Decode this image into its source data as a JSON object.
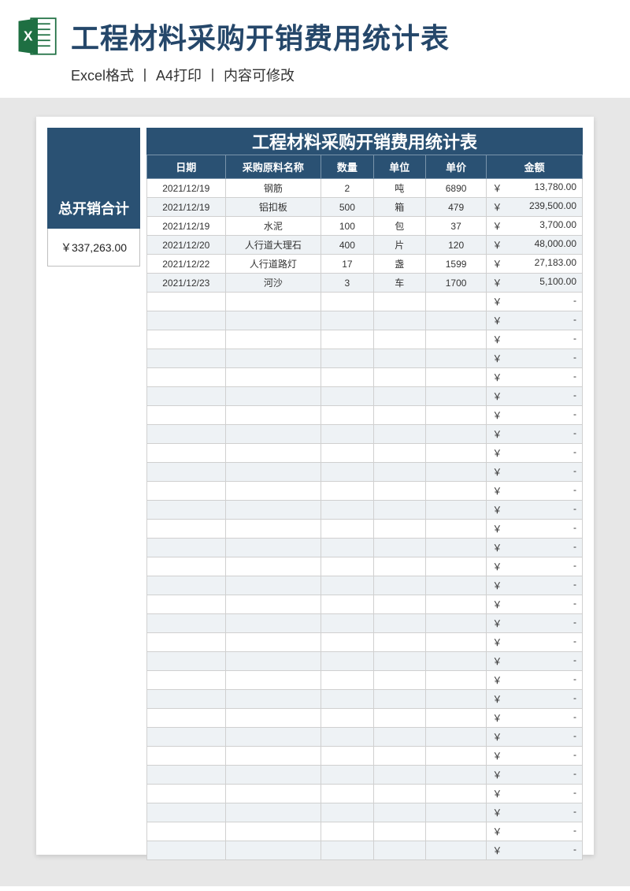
{
  "header": {
    "title": "工程材料采购开销费用统计表",
    "subtitle": "Excel格式 丨 A4打印 丨 内容可修改"
  },
  "left_panel": {
    "total_label": "总开销合计",
    "total_value": "￥337,263.00"
  },
  "table": {
    "title": "工程材料采购开销费用统计表",
    "columns": [
      "日期",
      "采购原料名称",
      "数量",
      "单位",
      "单价",
      "金额"
    ],
    "currency_symbol": "￥",
    "empty_amount": "-",
    "rows": [
      {
        "date": "2021/12/19",
        "name": "钢筋",
        "qty": "2",
        "unit": "吨",
        "price": "6890",
        "amount": "13,780.00"
      },
      {
        "date": "2021/12/19",
        "name": "铝扣板",
        "qty": "500",
        "unit": "箱",
        "price": "479",
        "amount": "239,500.00"
      },
      {
        "date": "2021/12/19",
        "name": "水泥",
        "qty": "100",
        "unit": "包",
        "price": "37",
        "amount": "3,700.00"
      },
      {
        "date": "2021/12/20",
        "name": "人行道大理石",
        "qty": "400",
        "unit": "片",
        "price": "120",
        "amount": "48,000.00"
      },
      {
        "date": "2021/12/22",
        "name": "人行道路灯",
        "qty": "17",
        "unit": "盏",
        "price": "1599",
        "amount": "27,183.00"
      },
      {
        "date": "2021/12/23",
        "name": "河沙",
        "qty": "3",
        "unit": "车",
        "price": "1700",
        "amount": "5,100.00"
      }
    ],
    "empty_row_count": 30
  }
}
